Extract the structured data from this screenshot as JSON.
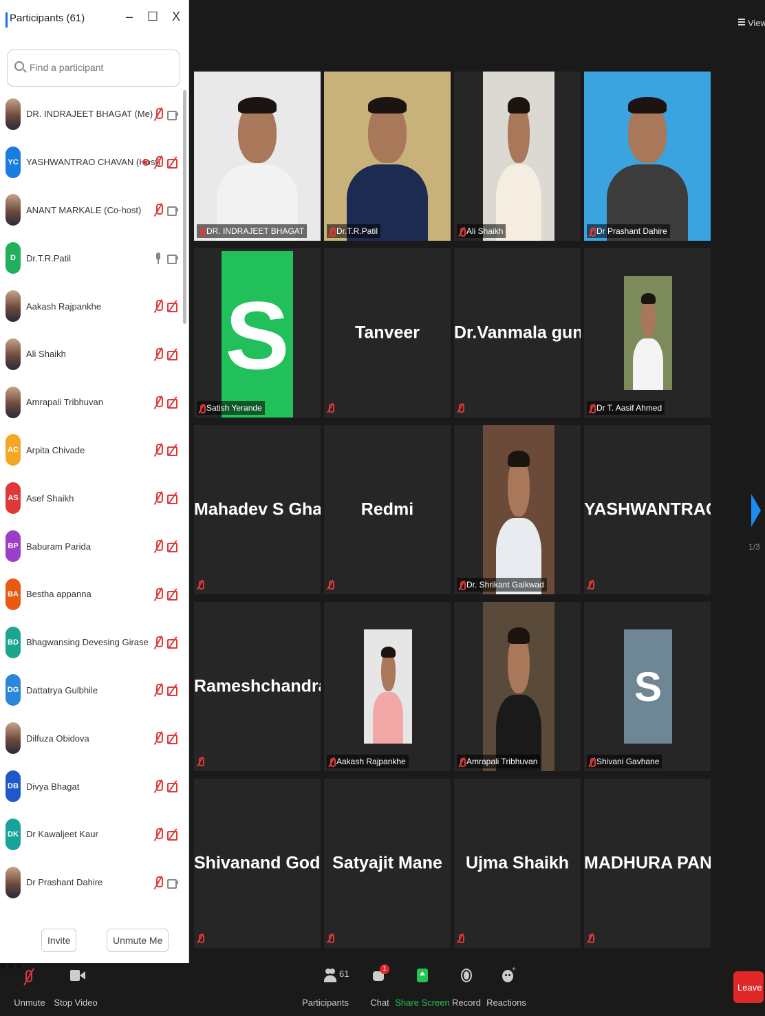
{
  "panel": {
    "title": "Participants (61)",
    "minimize": "–",
    "maximize": "☐",
    "close": "X",
    "search_placeholder": "Find a participant",
    "participants": [
      {
        "name": "DR. INDRAJEET BHAGAT (Me)",
        "initials": "",
        "color": "",
        "mic": "muted",
        "cam": "on",
        "rec": false
      },
      {
        "name": "YASHWANTRAO CHAVAN (Host)",
        "initials": "YC",
        "color": "#1a7be0",
        "mic": "muted",
        "cam": "off",
        "rec": true
      },
      {
        "name": "ANANT MARKALE (Co-host)",
        "initials": "",
        "color": "",
        "mic": "muted",
        "cam": "on",
        "rec": false
      },
      {
        "name": "Dr.T.R.Patil",
        "initials": "D",
        "color": "#23b05c",
        "mic": "on",
        "cam": "on",
        "rec": false
      },
      {
        "name": "Aakash Rajpankhe",
        "initials": "",
        "color": "",
        "mic": "muted",
        "cam": "off",
        "rec": false
      },
      {
        "name": "Ali Shaikh",
        "initials": "",
        "color": "",
        "mic": "muted",
        "cam": "off",
        "rec": false
      },
      {
        "name": "Amrapali Tribhuvan",
        "initials": "",
        "color": "",
        "mic": "muted",
        "cam": "off",
        "rec": false
      },
      {
        "name": "Arpita Chivade",
        "initials": "AC",
        "color": "#f5a623",
        "mic": "muted",
        "cam": "off",
        "rec": false
      },
      {
        "name": "Asef Shaikh",
        "initials": "AS",
        "color": "#e03838",
        "mic": "muted",
        "cam": "off",
        "rec": false
      },
      {
        "name": "Baburam Parida",
        "initials": "BP",
        "color": "#9b3fc6",
        "mic": "muted",
        "cam": "off",
        "rec": false
      },
      {
        "name": "Bestha appanna",
        "initials": "BA",
        "color": "#e85a12",
        "mic": "muted",
        "cam": "off",
        "rec": false
      },
      {
        "name": "Bhagwansing Devesing Girase",
        "initials": "BD",
        "color": "#1aa58f",
        "mic": "muted",
        "cam": "off",
        "rec": false
      },
      {
        "name": "Dattatrya Gulbhile",
        "initials": "DG",
        "color": "#2a86d8",
        "mic": "muted",
        "cam": "off",
        "rec": false
      },
      {
        "name": "Dilfuza Obidova",
        "initials": "",
        "color": "",
        "mic": "muted",
        "cam": "off",
        "rec": false
      },
      {
        "name": "Divya Bhagat",
        "initials": "DB",
        "color": "#1e58c9",
        "mic": "muted",
        "cam": "off",
        "rec": false
      },
      {
        "name": "Dr Kawaljeet Kaur",
        "initials": "DK",
        "color": "#17a29a",
        "mic": "muted",
        "cam": "off",
        "rec": false
      },
      {
        "name": "Dr Prashant Dahire",
        "initials": "",
        "color": "",
        "mic": "muted",
        "cam": "on",
        "rec": false
      }
    ],
    "invite": "Invite",
    "unmute_me": "Unmute Me"
  },
  "view_label": "View",
  "page_indicator": "1/3",
  "tiles": [
    {
      "kind": "video",
      "name": "DR. INDRAJEET BHAGAT",
      "speaker": false,
      "bg": "#e9e9e9",
      "shirt": "#f2f2f2"
    },
    {
      "kind": "video",
      "name": "Dr.T.R.Patil",
      "speaker": true,
      "bg": "#c9b27a",
      "shirt": "#1d2a52"
    },
    {
      "kind": "video",
      "name": "Ali Shaikh",
      "speaker": false,
      "bg": "#dcd8d2",
      "shirt": "#f4ede0"
    },
    {
      "kind": "video",
      "name": "Dr Prashant Dahire",
      "speaker": false,
      "bg": "#3aa3e0",
      "shirt": "#3c3c3c"
    },
    {
      "kind": "avatar",
      "name": "Satish Yerande",
      "letter": "S",
      "letter_bg": "#21c05a"
    },
    {
      "kind": "name",
      "name": "Tanveer",
      "display": "Tanveer"
    },
    {
      "kind": "name",
      "name": "Dr.Vanmala gun...",
      "display": "Dr.Vanmala gun..."
    },
    {
      "kind": "photo",
      "name": "Dr T. Aasif Ahmed",
      "bg": "#7d8a5a",
      "shirt": "#f4f4f4"
    },
    {
      "kind": "name",
      "name": "Mahadev S Ghatul",
      "display": "Mahadev S Ghatul"
    },
    {
      "kind": "name",
      "name": "Redmi",
      "display": "Redmi"
    },
    {
      "kind": "video",
      "name": "Dr. Shrikant Gaikwad",
      "speaker": false,
      "bg": "#6b4a3a",
      "shirt": "#e8ecf0"
    },
    {
      "kind": "name",
      "name": "YASHWANTRAO...",
      "display": "YASHWANTRAO..."
    },
    {
      "kind": "name",
      "name": "Rameshchandra....",
      "display": "Rameshchandra...."
    },
    {
      "kind": "photo",
      "name": "Aakash Rajpankhe",
      "bg": "#e6e6e6",
      "shirt": "#f3a8a8"
    },
    {
      "kind": "video",
      "name": "Amrapali Tribhuvan",
      "speaker": false,
      "bg": "#5a4a3a",
      "shirt": "#1a1a1a"
    },
    {
      "kind": "avatar",
      "name": "Shivani Gavhane",
      "letter": "S",
      "letter_bg": "#6f8795"
    },
    {
      "kind": "name",
      "name": "Shivanand Gode...",
      "display": "Shivanand Gode..."
    },
    {
      "kind": "name",
      "name": "Satyajit Mane",
      "display": "Satyajit Mane"
    },
    {
      "kind": "name",
      "name": "Ujma Shaikh",
      "display": "Ujma Shaikh"
    },
    {
      "kind": "name",
      "name": "MADHURA PAN...",
      "display": "MADHURA PAN..."
    }
  ],
  "toolbar": {
    "unmute": "Unmute",
    "stop_video": "Stop Video",
    "participants": "Participants",
    "participant_count": "61",
    "chat": "Chat",
    "chat_badge": "1",
    "share_screen": "Share Screen",
    "record": "Record",
    "reactions": "Reactions",
    "leave": "Leave"
  },
  "colors": {
    "accent": "#0e72ed",
    "share_green": "#23c552",
    "speaker_border": "#e8e84c",
    "muted_red": "#e03838",
    "leave_red": "#e02828"
  }
}
